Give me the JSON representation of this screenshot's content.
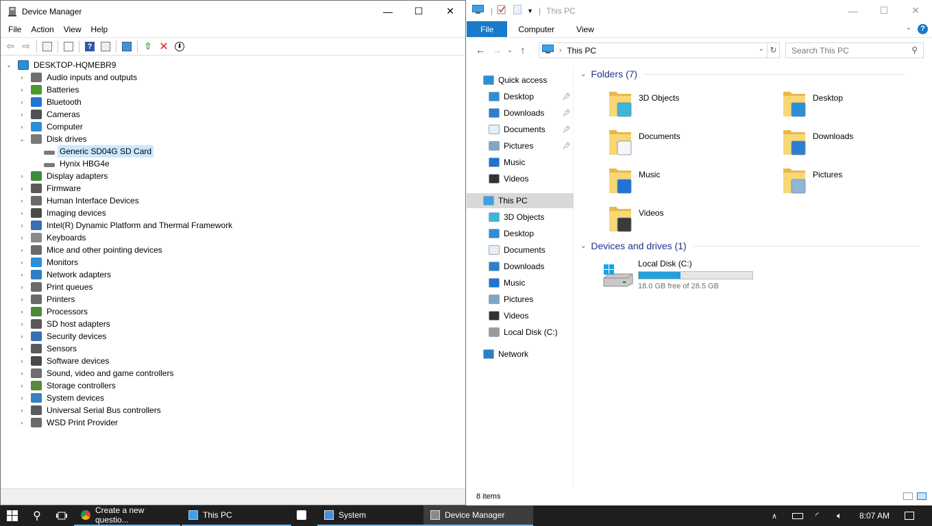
{
  "device_manager": {
    "title": "Device Manager",
    "menu": [
      "File",
      "Action",
      "View",
      "Help"
    ],
    "window_controls": {
      "minimize": "—",
      "maximize": "☐",
      "close": "✕"
    },
    "computer_name": "DESKTOP-HQMEBR9",
    "categories": [
      {
        "label": "Audio inputs and outputs",
        "icon": "speaker-icon",
        "color": "#6e6e6e"
      },
      {
        "label": "Batteries",
        "icon": "battery-icon",
        "color": "#4a9a2a"
      },
      {
        "label": "Bluetooth",
        "icon": "bluetooth-icon",
        "color": "#1f74d6"
      },
      {
        "label": "Cameras",
        "icon": "camera-icon",
        "color": "#505050"
      },
      {
        "label": "Computer",
        "icon": "monitor-icon",
        "color": "#2c8fd6"
      },
      {
        "label": "Disk drives",
        "icon": "disk-drive-icon",
        "color": "#7a7a7a",
        "expanded": true,
        "children": [
          "Generic SD04G SD Card",
          "Hynix HBG4e"
        ]
      },
      {
        "label": "Display adapters",
        "icon": "display-adapter-icon",
        "color": "#3c8c3c"
      },
      {
        "label": "Firmware",
        "icon": "firmware-icon",
        "color": "#5a5a5a"
      },
      {
        "label": "Human Interface Devices",
        "icon": "hid-icon",
        "color": "#6a6a6a"
      },
      {
        "label": "Imaging devices",
        "icon": "imaging-icon",
        "color": "#4a4a4a"
      },
      {
        "label": "Intel(R) Dynamic Platform and Thermal Framework",
        "icon": "chip-icon",
        "color": "#3a6fb0"
      },
      {
        "label": "Keyboards",
        "icon": "keyboard-icon",
        "color": "#8a8a8a"
      },
      {
        "label": "Mice and other pointing devices",
        "icon": "mouse-icon",
        "color": "#6a6a6a"
      },
      {
        "label": "Monitors",
        "icon": "monitor-icon",
        "color": "#2c8fd6"
      },
      {
        "label": "Network adapters",
        "icon": "network-icon",
        "color": "#2c7fc6"
      },
      {
        "label": "Print queues",
        "icon": "printer-icon",
        "color": "#6a6a6a"
      },
      {
        "label": "Printers",
        "icon": "printer-icon",
        "color": "#6a6a6a"
      },
      {
        "label": "Processors",
        "icon": "processor-icon",
        "color": "#4a8a3a"
      },
      {
        "label": "SD host adapters",
        "icon": "sd-host-icon",
        "color": "#5a5a5a"
      },
      {
        "label": "Security devices",
        "icon": "security-icon",
        "color": "#3a6fb0"
      },
      {
        "label": "Sensors",
        "icon": "sensor-icon",
        "color": "#5a5a5a"
      },
      {
        "label": "Software devices",
        "icon": "software-device-icon",
        "color": "#4a4a4a"
      },
      {
        "label": "Sound, video and game controllers",
        "icon": "speaker-icon",
        "color": "#6e6e6e"
      },
      {
        "label": "Storage controllers",
        "icon": "storage-icon",
        "color": "#5a8a3a"
      },
      {
        "label": "System devices",
        "icon": "system-icon",
        "color": "#3a7fc0"
      },
      {
        "label": "Universal Serial Bus controllers",
        "icon": "usb-icon",
        "color": "#5a5a5a"
      },
      {
        "label": "WSD Print Provider",
        "icon": "printer-icon",
        "color": "#6a6a6a"
      }
    ],
    "selected_child": "Generic SD04G SD Card"
  },
  "explorer": {
    "title": "This PC",
    "ribbon_tabs": [
      "File",
      "Computer",
      "View"
    ],
    "address": "This PC",
    "search_placeholder": "Search This PC",
    "nav": {
      "quick_access": "Quick access",
      "quick_items": [
        "Desktop",
        "Downloads",
        "Documents",
        "Pictures",
        "Music",
        "Videos"
      ],
      "this_pc": "This PC",
      "pc_items": [
        "3D Objects",
        "Desktop",
        "Documents",
        "Downloads",
        "Music",
        "Pictures",
        "Videos",
        "Local Disk (C:)"
      ],
      "network": "Network"
    },
    "folders_header": "Folders (7)",
    "folders": [
      "3D Objects",
      "Desktop",
      "Documents",
      "Downloads",
      "Music",
      "Pictures",
      "Videos"
    ],
    "drives_header": "Devices and drives (1)",
    "drive": {
      "label": "Local Disk (C:)",
      "free_text": "18.0 GB free of 28.5 GB",
      "used_fraction": 0.368
    },
    "status": "8 items"
  },
  "taskbar": {
    "apps": [
      {
        "label": "Create a new questio...",
        "icon": "chrome-icon"
      },
      {
        "label": "This PC",
        "icon": "this-pc-icon"
      },
      {
        "label": "",
        "icon": "store-icon"
      },
      {
        "label": "System",
        "icon": "system-app-icon"
      },
      {
        "label": "Device Manager",
        "icon": "device-manager-icon",
        "active": true
      }
    ],
    "time": "8:07 AM"
  }
}
